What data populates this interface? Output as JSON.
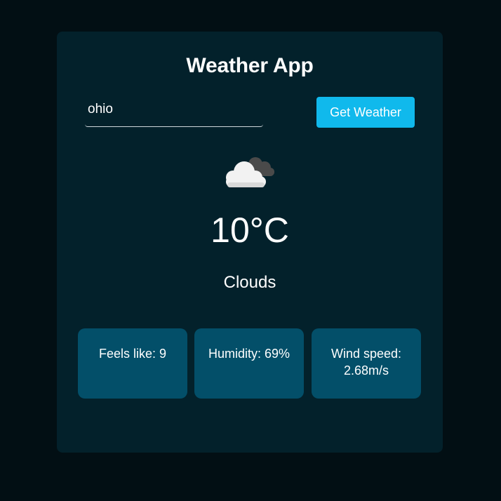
{
  "app": {
    "title": "Weather App"
  },
  "search": {
    "value": "ohio",
    "button_label": "Get Weather"
  },
  "weather": {
    "icon": "cloud-icon",
    "temperature": "10°C",
    "description": "Clouds"
  },
  "stats": {
    "feels_like": "Feels like: 9",
    "humidity": "Humidity: 69%",
    "wind_speed": "Wind speed: 2.68m/s"
  },
  "colors": {
    "page_background": "#020f14",
    "card_background": "#03212b",
    "accent": "#10b9ec",
    "stat_background": "#034f69"
  }
}
